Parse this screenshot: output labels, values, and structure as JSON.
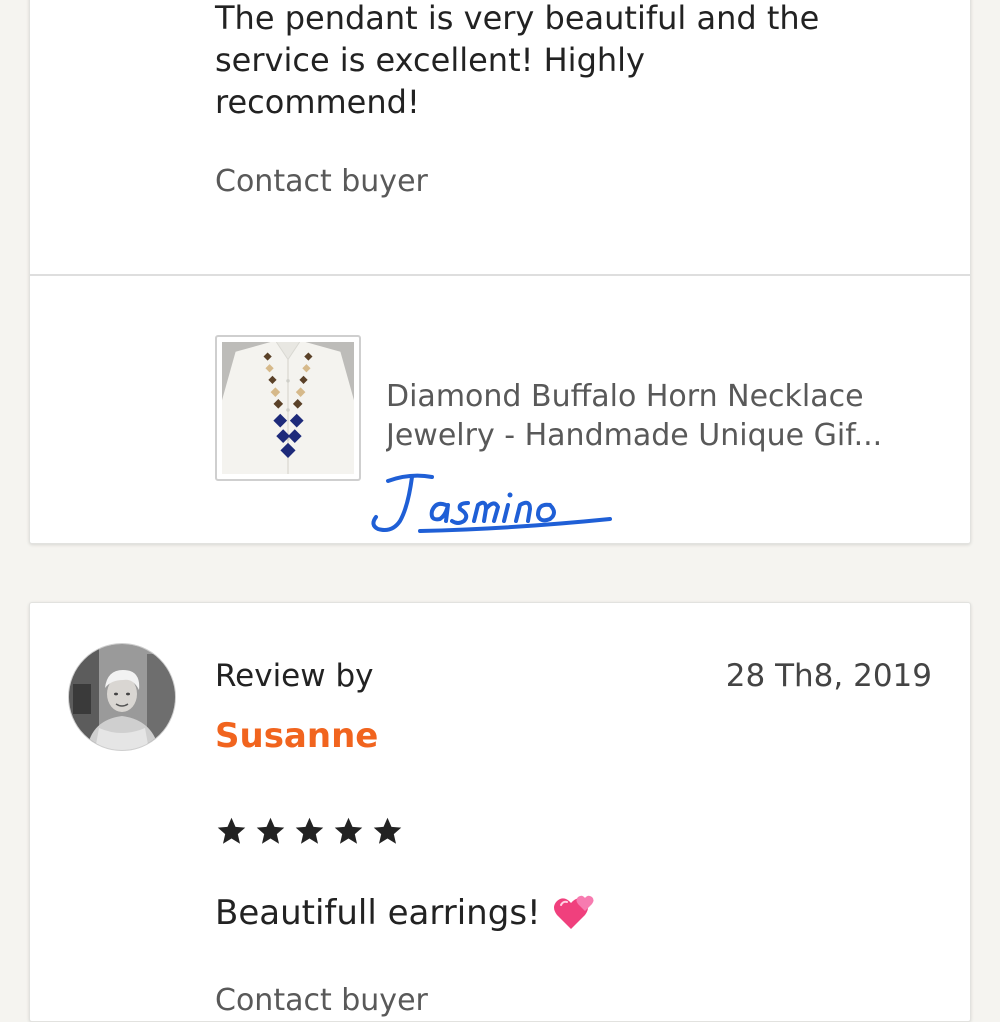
{
  "review_1": {
    "text": "The pendant is very beautiful and the service is excellent! Highly recommend!",
    "contact_label": "Contact buyer",
    "product": {
      "title_line1": "Diamond Buffalo Horn Necklace",
      "title_line2": "Jewelry - Handmade Unique Gif..."
    },
    "watermark": "Jasmino"
  },
  "review_2": {
    "review_by_label": "Review by",
    "reviewer_name": "Susanne",
    "date": "28 Th8, 2019",
    "rating": 5,
    "rating_max": 5,
    "text": "Beautifull earrings!",
    "emoji": "two-hearts-emoji",
    "contact_label": "Contact buyer"
  },
  "colors": {
    "background": "#f5f4f0",
    "reviewer_name": "#f1641e",
    "watermark": "#1f5fd6",
    "muted_text": "#595959"
  }
}
